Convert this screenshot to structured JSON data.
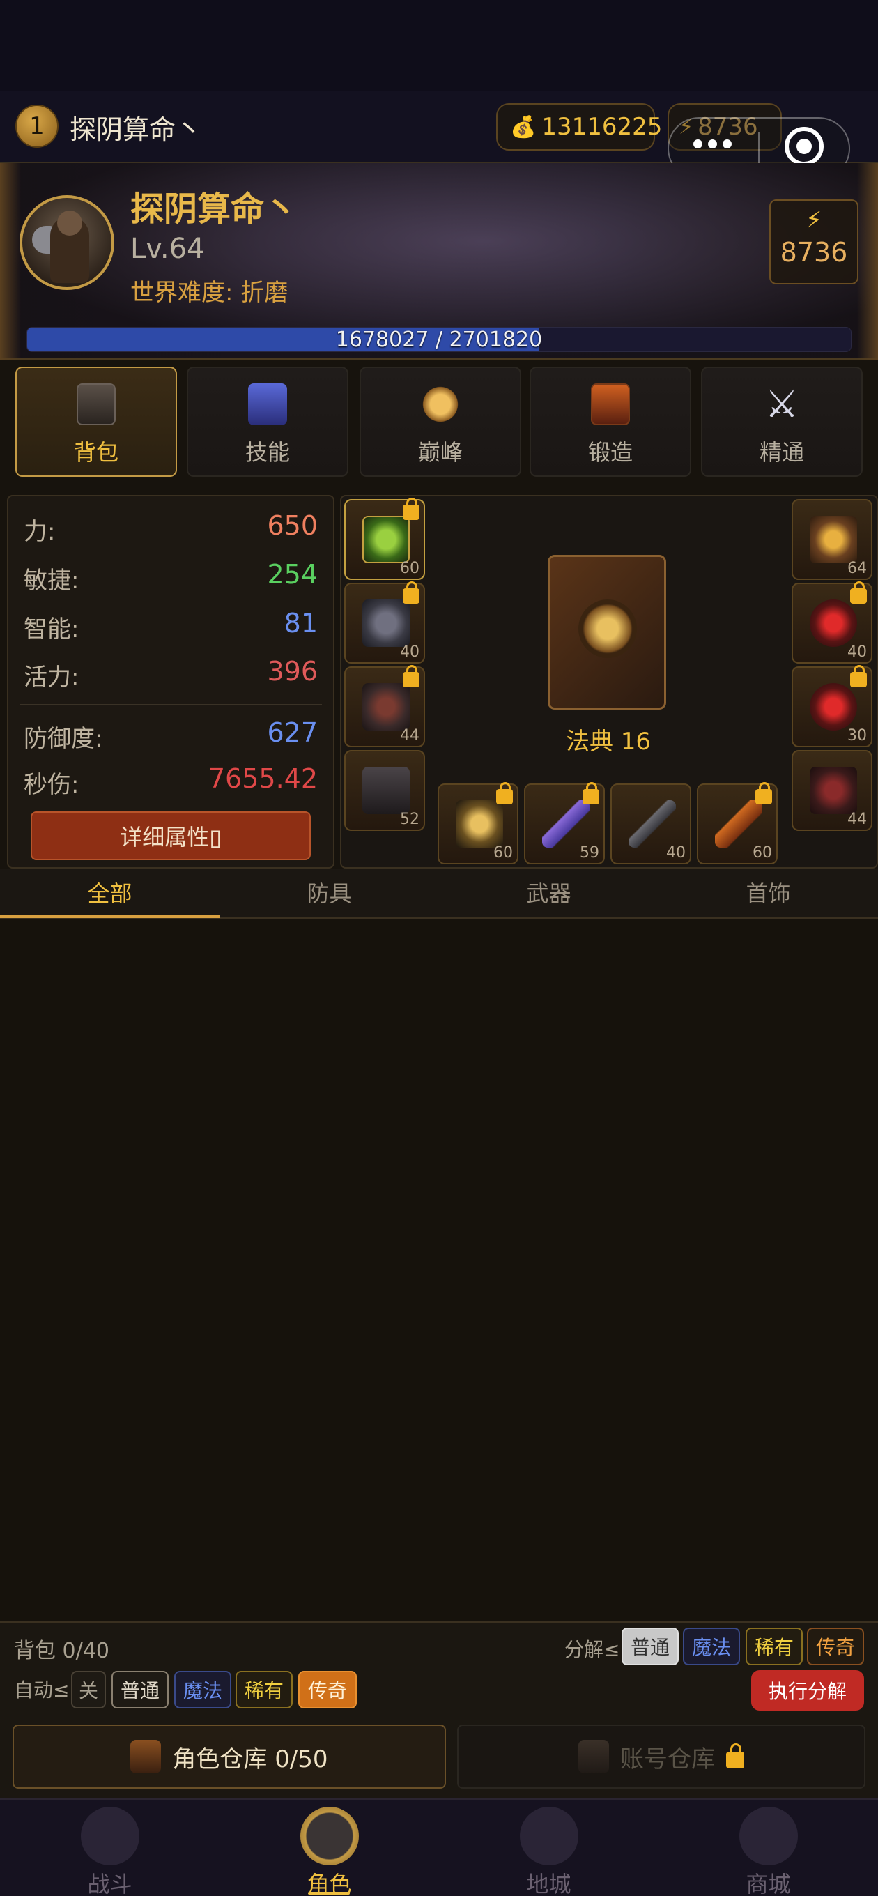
{
  "top_bar": {
    "level": "1",
    "name": "探阴算命丶",
    "gold": "13116225",
    "gold_icon": "money-bag-icon",
    "energy": "8736",
    "energy_icon": "lightning-icon"
  },
  "hero": {
    "name": "探阴算命丶",
    "level": "Lv.64",
    "difficulty": "世界难度: 折磨",
    "power": "8736",
    "xp_text": "1678027 / 2701820",
    "xp_fraction": 0.621
  },
  "tabs": [
    {
      "label": "背包",
      "icon": "backpack-icon",
      "active": true
    },
    {
      "label": "技能",
      "icon": "skill-rune-icon",
      "active": false
    },
    {
      "label": "巅峰",
      "icon": "paragon-star-icon",
      "active": false
    },
    {
      "label": "锻造",
      "icon": "forge-chest-icon",
      "active": false
    },
    {
      "label": "精通",
      "icon": "crossed-swords-icon",
      "active": false
    }
  ],
  "stats": {
    "strength": {
      "label": "力:",
      "value": "650",
      "color": "#f08060"
    },
    "dexterity": {
      "label": "敏捷:",
      "value": "254",
      "color": "#5ad060"
    },
    "intelligence": {
      "label": "智能:",
      "value": "81",
      "color": "#6a8ff0"
    },
    "vitality": {
      "label": "活力:",
      "value": "396",
      "color": "#e05a5a"
    },
    "defense": {
      "label": "防御度:",
      "value": "627",
      "color": "#6a8ff0"
    },
    "dps": {
      "label": "秒伤:",
      "value": "7655.42",
      "color": "#e04848"
    },
    "detail_button": "详细属性▯"
  },
  "equipment": {
    "center_item": "法典 16",
    "left_slots": [
      {
        "slot": "helmet",
        "level": "60",
        "locked": true
      },
      {
        "slot": "chest",
        "level": "40",
        "locked": true
      },
      {
        "slot": "gloves",
        "level": "44",
        "locked": true
      },
      {
        "slot": "pants",
        "level": "52",
        "locked": false
      }
    ],
    "right_slots": [
      {
        "slot": "amulet",
        "level": "64",
        "locked": false
      },
      {
        "slot": "ring-1",
        "level": "40",
        "locked": true
      },
      {
        "slot": "ring-2",
        "level": "30",
        "locked": true
      },
      {
        "slot": "boots",
        "level": "44",
        "locked": false
      }
    ],
    "bottom_slots": [
      {
        "slot": "main-hand-axe",
        "level": "60",
        "locked": true
      },
      {
        "slot": "sword",
        "level": "59",
        "locked": true
      },
      {
        "slot": "axe",
        "level": "40",
        "locked": false
      },
      {
        "slot": "hammer",
        "level": "60",
        "locked": true
      }
    ]
  },
  "filter_tabs": [
    "全部",
    "防具",
    "武器",
    "首饰"
  ],
  "controls": {
    "bag_count": "背包 0/40",
    "decompose_label": "分解≤",
    "decompose_options": [
      "普通",
      "魔法",
      "稀有",
      "传奇"
    ],
    "auto_label": "自动≤",
    "auto_options": [
      "关",
      "普通",
      "魔法",
      "稀有",
      "传奇"
    ],
    "execute_button": "执行分解",
    "role_storage": "角色仓库 0/50",
    "account_storage": "账号仓库"
  },
  "nav": [
    {
      "label": "战斗",
      "icon": "battle-icon",
      "active": false
    },
    {
      "label": "角色",
      "icon": "character-helmet-icon",
      "active": true
    },
    {
      "label": "地城",
      "icon": "dungeon-icon",
      "active": false
    },
    {
      "label": "商城",
      "icon": "shop-icon",
      "active": false
    }
  ],
  "colors": {
    "accent_gold": "#f0c040",
    "xp_blue": "#2e4aa8",
    "execute_red": "#c02a24"
  }
}
